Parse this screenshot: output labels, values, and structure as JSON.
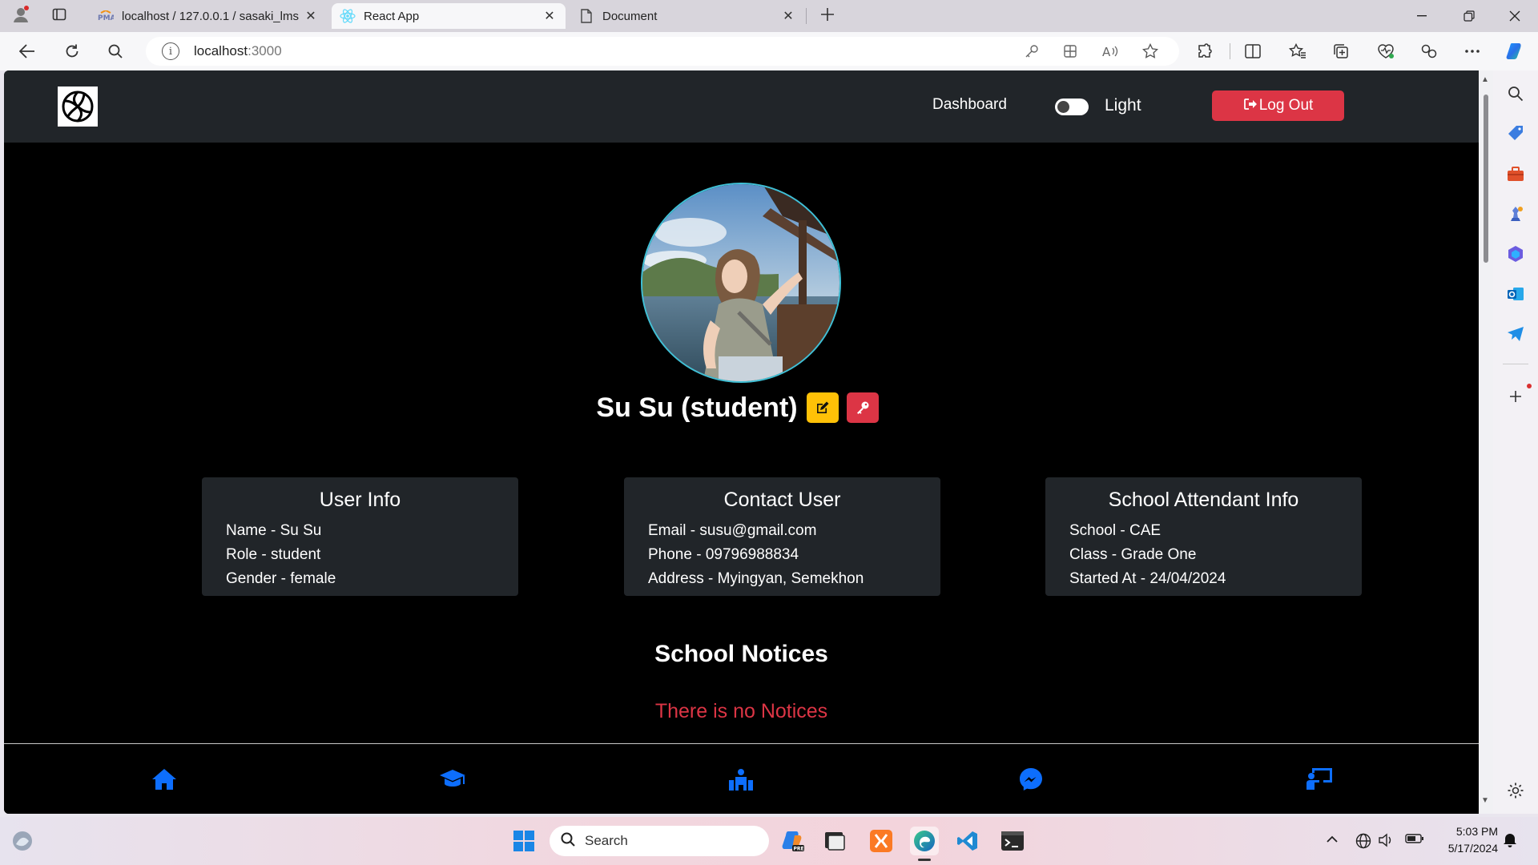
{
  "browser": {
    "tabs": [
      {
        "label": "localhost / 127.0.0.1 / sasaki_lms",
        "icon": "phpmyadmin-icon"
      },
      {
        "label": "React App",
        "icon": "react-icon",
        "active": true
      },
      {
        "label": "Document",
        "icon": "document-icon"
      }
    ],
    "url": {
      "host": "localhost",
      "port": ":3000"
    }
  },
  "app": {
    "nav": {
      "dashboard_label": "Dashboard",
      "theme_toggle_label": "Light",
      "logout_label": "Log Out"
    },
    "profile": {
      "name": "Su Su (student)"
    },
    "cards": [
      {
        "title": "User Info",
        "lines": [
          "Name - Su Su",
          "Role - student",
          "Gender - female"
        ]
      },
      {
        "title": "Contact User",
        "lines": [
          "Email - susu@gmail.com",
          "Phone - 09796988834",
          "Address - Myingyan, Semekhon"
        ]
      },
      {
        "title": "School Attendant Info",
        "lines": [
          "School - CAE",
          "Class - Grade One",
          "Started At - 24/04/2024"
        ]
      }
    ],
    "notices": {
      "title": "School Notices",
      "empty_text": "There is no Notices"
    },
    "footer_icons": [
      "home-icon",
      "graduation-cap-icon",
      "school-icon",
      "messenger-icon",
      "chalkboard-teacher-icon"
    ],
    "colors": {
      "accent_blue": "#0d6efd",
      "danger": "#dc3545",
      "warning": "#ffc107",
      "navbar": "#212529",
      "card": "#212529"
    }
  },
  "taskbar": {
    "search_label": "Search",
    "time": "5:03 PM",
    "date": "5/17/2024"
  }
}
